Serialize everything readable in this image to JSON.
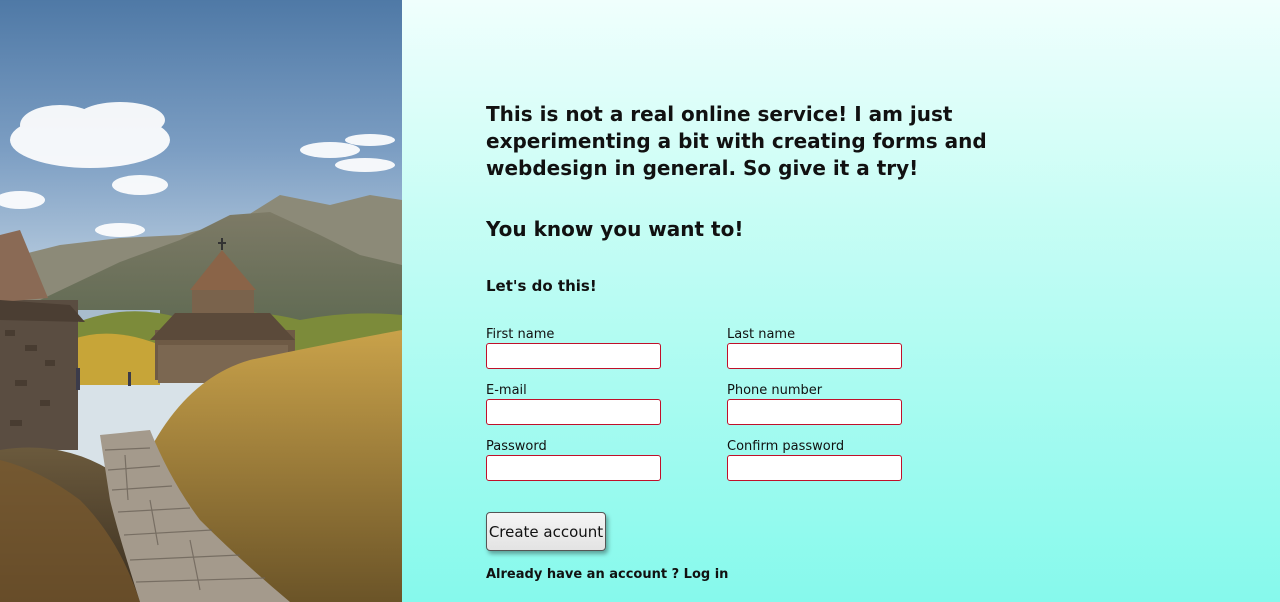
{
  "intro": {
    "paragraph": "This is not a real online service! I am just experimenting a bit with creating forms and webdesign in general. So give it a try!",
    "tagline": "You know you want to!"
  },
  "form": {
    "heading": "Let's do this!",
    "fields": {
      "first_name": {
        "label": "First name",
        "value": ""
      },
      "last_name": {
        "label": "Last name",
        "value": ""
      },
      "email": {
        "label": "E-mail",
        "value": ""
      },
      "phone": {
        "label": "Phone number",
        "value": ""
      },
      "password": {
        "label": "Password",
        "value": ""
      },
      "confirm_password": {
        "label": "Confirm password",
        "value": ""
      }
    },
    "submit_label": "Create account",
    "login_prompt": "Already have an account ?",
    "login_link": "Log in"
  },
  "colors": {
    "input_border": "#c0102a",
    "gradient_top": "#f0fffd",
    "gradient_bottom": "#86f9ec",
    "text": "#111111"
  }
}
